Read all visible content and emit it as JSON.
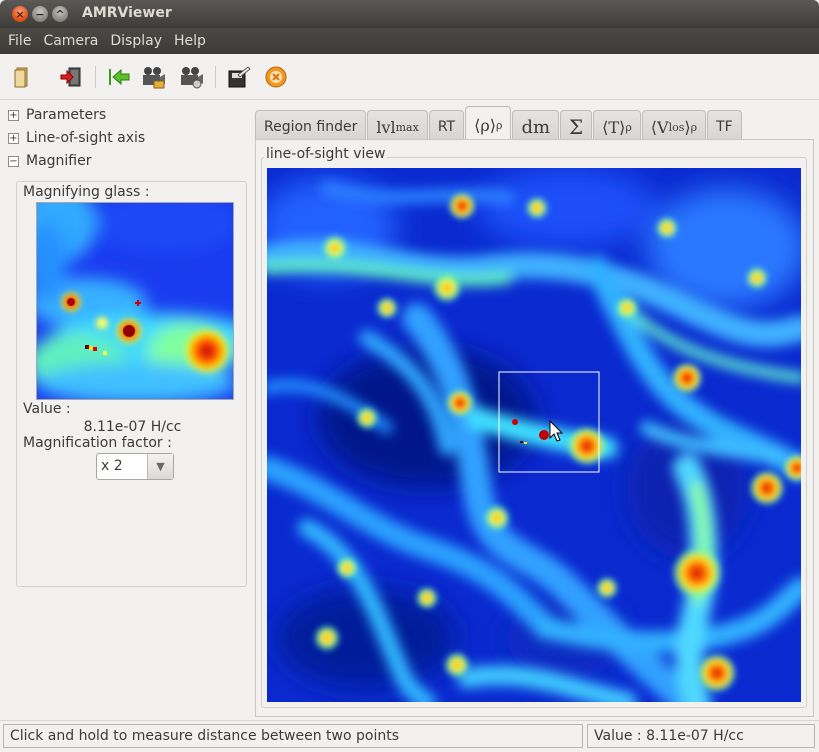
{
  "window": {
    "title": "AMRViewer"
  },
  "menu": [
    {
      "label": "File"
    },
    {
      "label": "Camera"
    },
    {
      "label": "Display"
    },
    {
      "label": "Help"
    }
  ],
  "toolbar": {
    "icons": [
      "open-icon",
      "exit-icon",
      "back-arrow-icon",
      "camera-icon",
      "camera-settings-icon",
      "save-icon",
      "record-icon"
    ]
  },
  "sidebar": {
    "expanders": [
      {
        "label": "Parameters",
        "state": "+"
      },
      {
        "label": "Line-of-sight axis",
        "state": "+"
      },
      {
        "label": "Magnifier",
        "state": "−"
      }
    ],
    "magnifier": {
      "title": "Magnifying glass :",
      "value_label": "Value :",
      "value": "8.11e-07 H/cc",
      "factor_label": "Magnification factor :",
      "factor_value": "x 2"
    }
  },
  "tabs": [
    {
      "label": "Region finder"
    },
    {
      "label": "lvl",
      "sub": "max"
    },
    {
      "label": "RT"
    },
    {
      "label": "⟨ρ⟩",
      "sub": "ρ"
    },
    {
      "label": "dm"
    },
    {
      "label": "Σ"
    },
    {
      "label": "⟨T⟩",
      "sub": "ρ"
    },
    {
      "label": "⟨V",
      "sub2": "los",
      "tail": "⟩",
      "sub": "ρ"
    },
    {
      "label": "TF"
    }
  ],
  "view": {
    "title": "line-of-sight view"
  },
  "status": {
    "message": "Click and hold to measure distance between two points",
    "value": "Value : 8.11e-07 H/cc"
  },
  "colors": {
    "titlebar": "#3c3b37",
    "close": "#e5531a",
    "bg": "#f2f1f0"
  }
}
